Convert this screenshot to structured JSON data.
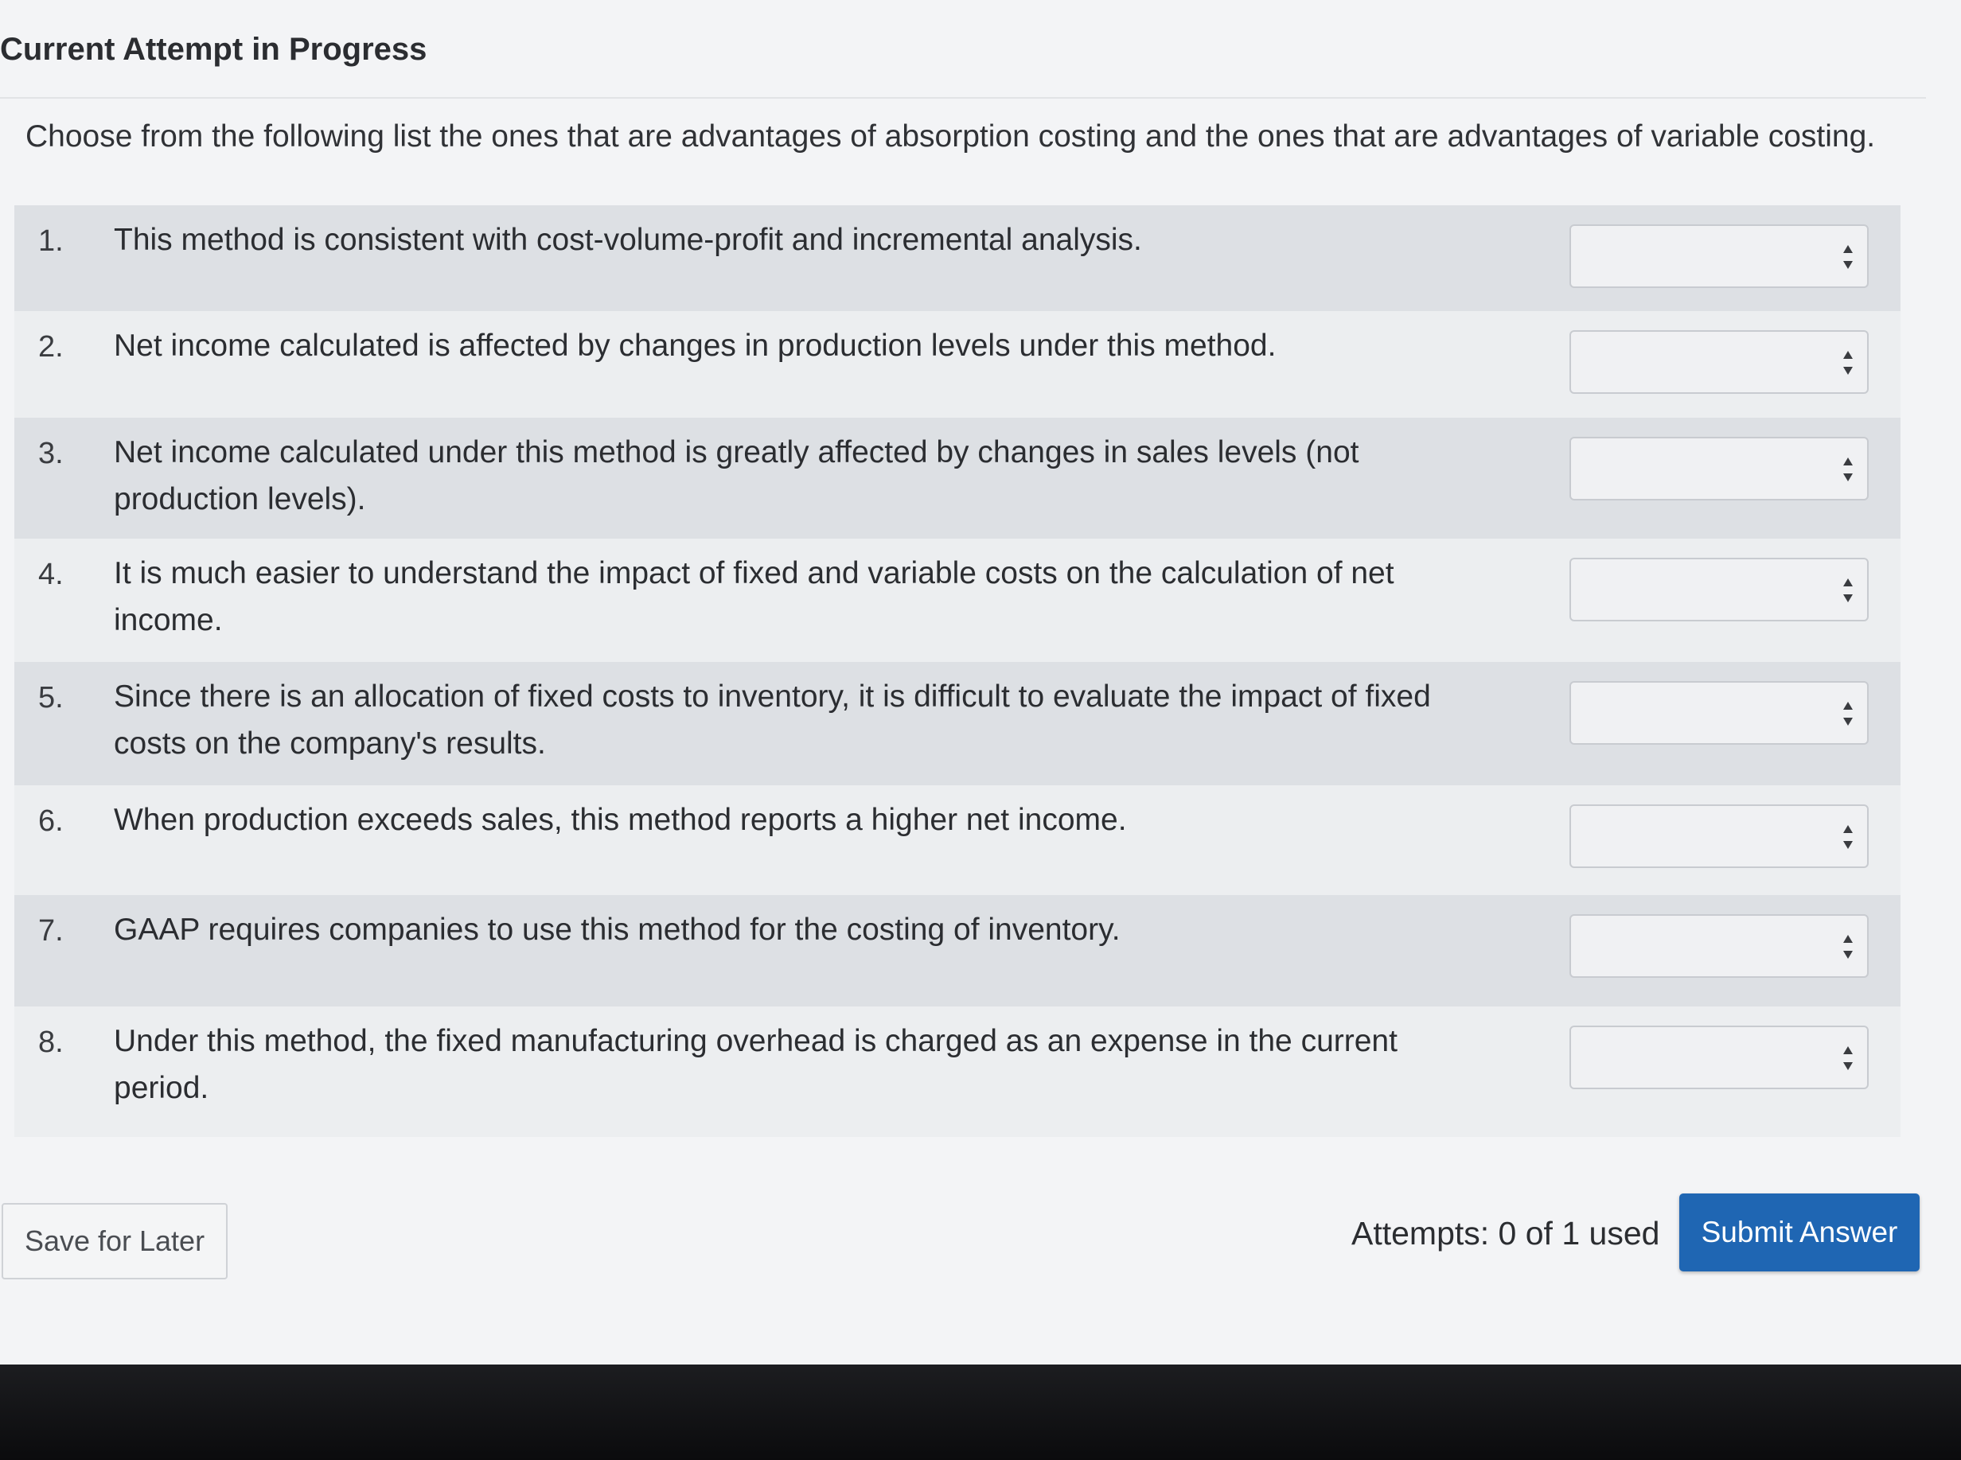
{
  "header": {
    "title": "Current Attempt in Progress"
  },
  "instructions": "Choose from the following list the ones that are advantages of absorption costing and the ones that are advantages of variable costing.",
  "questions": [
    {
      "number": "1.",
      "text": "This method is consistent with cost-volume-profit and incremental analysis.",
      "selected": ""
    },
    {
      "number": "2.",
      "text": "Net income calculated is affected by changes in production levels under this method.",
      "selected": ""
    },
    {
      "number": "3.",
      "text": "Net income calculated under this method is greatly affected by changes in sales levels (not production levels).",
      "selected": ""
    },
    {
      "number": "4.",
      "text": "It is much easier to understand the impact of fixed and variable costs on the calculation of net income.",
      "selected": ""
    },
    {
      "number": "5.",
      "text": "Since there is an allocation of fixed costs to inventory, it is difficult to evaluate the impact of fixed costs on the company's results.",
      "selected": ""
    },
    {
      "number": "6.",
      "text": "When production exceeds sales, this method reports a higher net income.",
      "selected": ""
    },
    {
      "number": "7.",
      "text": "GAAP requires companies to use this method for the costing of inventory.",
      "selected": ""
    },
    {
      "number": "8.",
      "text": "Under this method, the fixed manufacturing overhead is charged as an expense in the current period.",
      "selected": ""
    }
  ],
  "footer": {
    "save_label": "Save for Later",
    "attempts_text": "Attempts: 0 of 1 used",
    "submit_label": "Submit Answer"
  },
  "colors": {
    "submit_button": "#1f66b3",
    "row_shaded": "#dde0e4",
    "row_plain": "#eceef0"
  }
}
